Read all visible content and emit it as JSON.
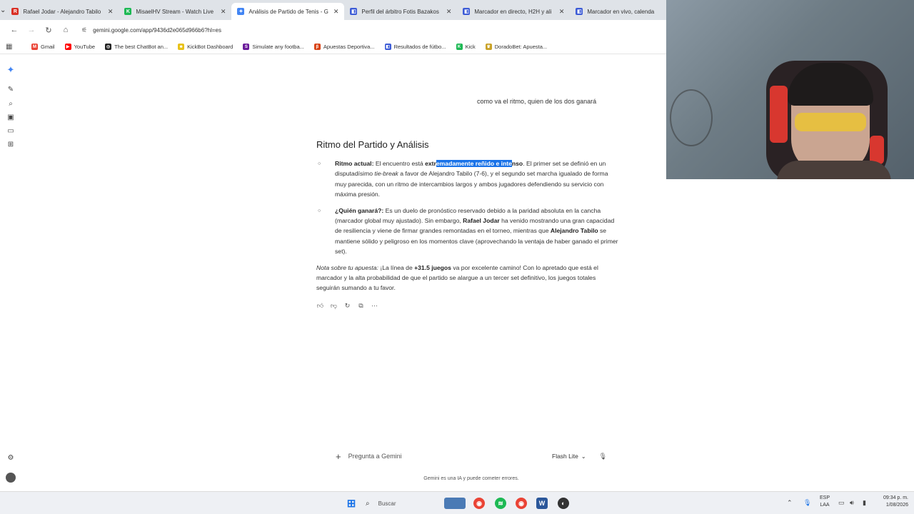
{
  "browser": {
    "tabs": [
      {
        "title": "Rafael Jodar - Alejandro Tabilo",
        "color": "#d93025",
        "icon": "R",
        "active": false
      },
      {
        "title": "MisaelHV Stream - Watch Live",
        "color": "#1db954",
        "icon": "K",
        "active": false
      },
      {
        "title": "Análisis de Partido de Tenis - G",
        "color": "#4285f4",
        "icon": "✦",
        "active": true
      },
      {
        "title": "Perfil del árbitro Fotis Bazakos",
        "color": "#3c5bd6",
        "icon": "◧",
        "active": false
      },
      {
        "title": "Marcador en directo, H2H y ali",
        "color": "#3c5bd6",
        "icon": "◧",
        "active": false
      },
      {
        "title": "Marcador en vivo, calenda",
        "color": "#3c5bd6",
        "icon": "◧",
        "active": false
      }
    ],
    "url": "gemini.google.com/app/9436d2e065d966b6?hl=es",
    "bookmarks": [
      {
        "label": "Gmail",
        "color": "#ea4335",
        "icon": "M"
      },
      {
        "label": "YouTube",
        "color": "#ff0000",
        "icon": "▶"
      },
      {
        "label": "The best ChatBot an...",
        "color": "#222222",
        "icon": "◎"
      },
      {
        "label": "KickBot Dashboard",
        "color": "#e8c21a",
        "icon": "☻"
      },
      {
        "label": "Simulate any footba...",
        "color": "#6a1b9a",
        "icon": "S"
      },
      {
        "label": "Apuestas Deportiva...",
        "color": "#d84315",
        "icon": "β"
      },
      {
        "label": "Resultados de fútbo...",
        "color": "#3c5bd6",
        "icon": "◧"
      },
      {
        "label": "Kick",
        "color": "#1db954",
        "icon": "K"
      },
      {
        "label": "DoradoBet: Apuesta...",
        "color": "#c9a227",
        "icon": "♛"
      }
    ]
  },
  "chat": {
    "user_query": "como va el ritmo, quien de los dos ganará",
    "heading": "Ritmo del Partido y Análisis",
    "item1": {
      "label": "Ritmo actual:",
      "t1": " El encuentro está ",
      "bold_pre": "extr",
      "highlight": "emadamente reñido e inte",
      "bold_post": "nso",
      "t2": ". El primer set se definió en un disputadísimo ",
      "em": "tie-break",
      "t3": " a favor de Alejandro Tabilo (7-6), y el segundo set marcha igualado de forma muy parecida, con un ritmo de intercambios largos y ambos jugadores defendiendo su servicio con máxima presión."
    },
    "item2": {
      "label": "¿Quién ganará?:",
      "t1": " Es un duelo de pronóstico reservado debido a la paridad absoluta en la cancha (marcador global muy ajustado). Sin embargo, ",
      "b1": "Rafael Jodar",
      "t2": " ha venido mostrando una gran capacidad de resiliencia y viene de firmar grandes remontadas en el torneo, mientras que ",
      "b2": "Alejandro Tabilo",
      "t3": " se mantiene sólido y peligroso en los momentos clave (aprovechando la ventaja de haber ganado el primer set)."
    },
    "note": {
      "em": "Nota sobre tu apuesta:",
      "t1": " ¡La línea de ",
      "b": "+31.5 juegos",
      "t2": " va por excelente camino! Con lo apretado que está el marcador y la alta probabilidad de que el partido se alargue a un tercer set definitivo, los juegos totales seguirán sumando a tu favor."
    },
    "prompt_placeholder": "Pregunta a Gemini",
    "model": "Flash Lite",
    "disclaimer": "Gemini es una IA y puede cometer errores."
  },
  "taskbar": {
    "search": "Buscar",
    "lang1": "ESP",
    "lang2": "LAA",
    "time": "09:34 p. m.",
    "date": "1/08/2026"
  }
}
